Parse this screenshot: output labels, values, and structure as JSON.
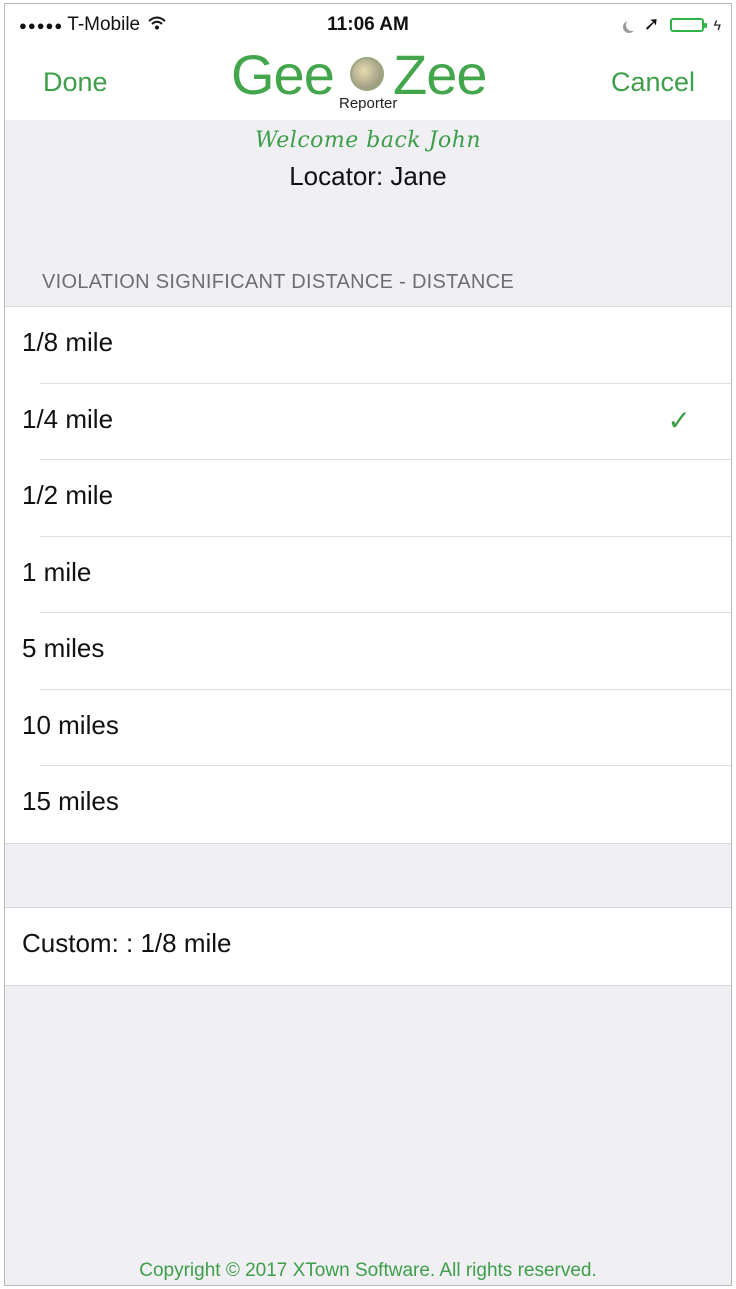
{
  "status_bar": {
    "signal_dots": "●●●●●",
    "carrier": "T-Mobile",
    "wifi_icon": "wifi-icon",
    "time": "11:06 AM",
    "location_arrow": "➚",
    "bolt": "ϟ"
  },
  "nav": {
    "done_label": "Done",
    "cancel_label": "Cancel",
    "logo_left": "Gee",
    "logo_right": "Zee",
    "logo_sub": "Reporter"
  },
  "welcome": {
    "greeting": "Welcome back John",
    "locator": "Locator: Jane"
  },
  "section": {
    "header": "VIOLATION SIGNIFICANT DISTANCE - DISTANCE"
  },
  "options": [
    {
      "label": "1/8 mile",
      "selected": false
    },
    {
      "label": "1/4 mile",
      "selected": true
    },
    {
      "label": "1/2 mile",
      "selected": false
    },
    {
      "label": "1 mile",
      "selected": false
    },
    {
      "label": "5 miles",
      "selected": false
    },
    {
      "label": "10 miles",
      "selected": false
    },
    {
      "label": "15 miles",
      "selected": false
    }
  ],
  "check_glyph": "✓",
  "custom": {
    "label": "Custom: : 1/8 mile"
  },
  "footer": {
    "copyright": "Copyright ©  2017 XTown Software. All rights reserved."
  },
  "colors": {
    "accent": "#3e9e49",
    "background": "#efeff4"
  }
}
